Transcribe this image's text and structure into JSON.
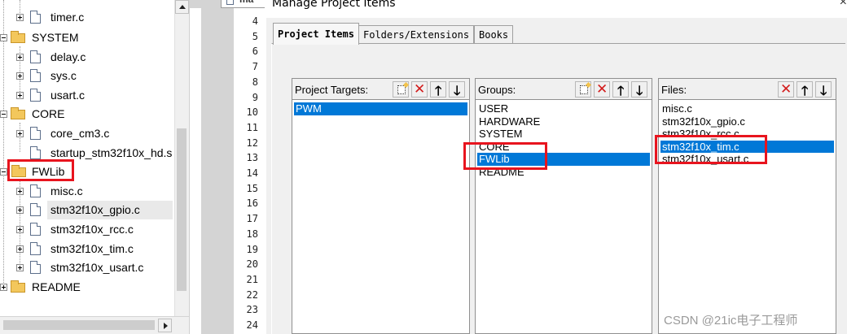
{
  "tree": {
    "items": [
      {
        "label": "timer.c",
        "kind": "file"
      },
      {
        "label": "SYSTEM",
        "kind": "folder"
      },
      {
        "label": "delay.c",
        "kind": "file"
      },
      {
        "label": "sys.c",
        "kind": "file"
      },
      {
        "label": "usart.c",
        "kind": "file"
      },
      {
        "label": "CORE",
        "kind": "folder"
      },
      {
        "label": "core_cm3.c",
        "kind": "file"
      },
      {
        "label": "startup_stm32f10x_hd.s",
        "kind": "file"
      },
      {
        "label": "FWLib",
        "kind": "folder-open"
      },
      {
        "label": "misc.c",
        "kind": "file"
      },
      {
        "label": "stm32f10x_gpio.c",
        "kind": "file"
      },
      {
        "label": "stm32f10x_rcc.c",
        "kind": "file"
      },
      {
        "label": "stm32f10x_tim.c",
        "kind": "file"
      },
      {
        "label": "stm32f10x_usart.c",
        "kind": "file"
      },
      {
        "label": "README",
        "kind": "folder"
      }
    ]
  },
  "editor": {
    "tab_label": "ma",
    "line_numbers": [
      "4",
      "5",
      "6",
      "7",
      "8",
      "9",
      "10",
      "11",
      "12",
      "13",
      "14",
      "15",
      "16",
      "17",
      "18",
      "19",
      "20",
      "21",
      "22",
      "23",
      "24"
    ]
  },
  "dialog": {
    "title": "Manage Project Items",
    "close_glyph": "×",
    "tabs": [
      "Project Items",
      "Folders/Extensions",
      "Books"
    ],
    "targets": {
      "title": "Project Targets:",
      "items": [
        "PWM"
      ],
      "selected": 0
    },
    "groups": {
      "title": "Groups:",
      "items": [
        "USER",
        "HARDWARE",
        "SYSTEM",
        "CORE",
        "FWLib",
        "README"
      ],
      "selected": 4
    },
    "files": {
      "title": "Files:",
      "items": [
        "misc.c",
        "stm32f10x_gpio.c",
        "stm32f10x_rcc.c",
        "stm32f10x_tim.c",
        "stm32f10x_usart.c"
      ],
      "selected": 3
    }
  },
  "colors": {
    "selection": "#0078d7",
    "annotation_red": "#e8141e",
    "folder": "#f3c75c"
  },
  "watermark": "CSDN @21ic电子工程师"
}
